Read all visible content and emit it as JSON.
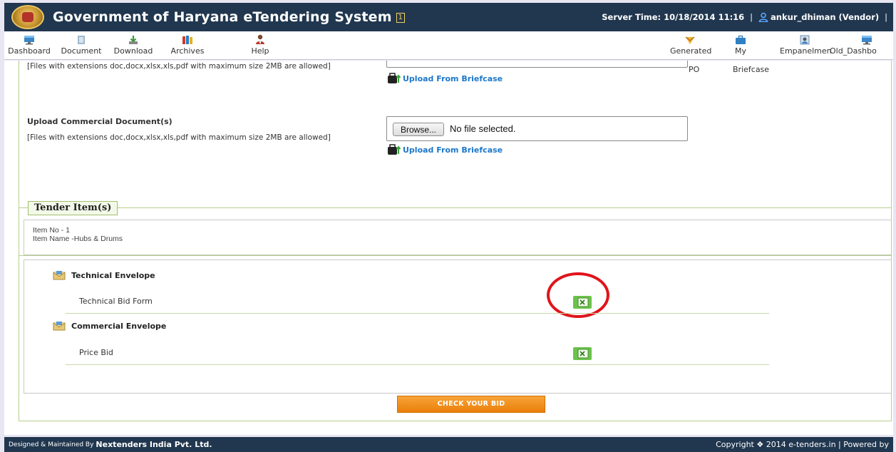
{
  "header": {
    "title": "Government of Haryana eTendering System",
    "badge": "1",
    "server_time": "Server Time: 10/18/2014 11:16",
    "separator": "|",
    "user": "ankur_dhiman (Vendor)",
    "user_trailing_sep": "|"
  },
  "toolbar": {
    "left": [
      {
        "label": "Dashboard",
        "icon": "dashboard-icon"
      },
      {
        "label": "Document",
        "icon": "document-icon"
      },
      {
        "label": "Download",
        "icon": "download-icon"
      },
      {
        "label": "Archives",
        "icon": "archives-icon"
      },
      {
        "label": "Help",
        "icon": "help-icon"
      }
    ],
    "right": [
      {
        "label": "Generated",
        "sub": "PO",
        "icon": "generated-po-icon"
      },
      {
        "label": "My",
        "sub": "Briefcase",
        "icon": "briefcase-icon"
      },
      {
        "label": "Empanelmen",
        "icon": "empanelment-icon"
      },
      {
        "label": "Old_Dashbo",
        "icon": "old-dashboard-icon"
      }
    ]
  },
  "technical_upload": {
    "note": "[Files with extensions doc,docx,xlsx,xls,pdf with maximum size 2MB are allowed]",
    "briefcase_link": "Upload From Briefcase"
  },
  "commercial_upload": {
    "label": "Upload Commercial Document(s)",
    "note": "[Files with extensions doc,docx,xlsx,xls,pdf with maximum size 2MB are allowed]",
    "browse": "Browse...",
    "file_status": "No file selected.",
    "briefcase_link": "Upload From Briefcase"
  },
  "tender_items": {
    "legend": "Tender Item(s)",
    "item_no": "Item No - 1",
    "item_name": "Item Name -Hubs & Drums",
    "envelopes": [
      {
        "title": "Technical Envelope",
        "row": "Technical Bid Form"
      },
      {
        "title": "Commercial Envelope",
        "row": "Price Bid"
      }
    ]
  },
  "actions": {
    "check_bid": "CHECK YOUR BID"
  },
  "footer": {
    "designed_by": "Designed & Maintained By",
    "company": "Nextenders India Pvt. Ltd.",
    "copyright": "Copyright ❖ 2014 e-tenders.in | Powered by"
  },
  "colors": {
    "header_bg": "#21374f",
    "link": "#1d77c9",
    "section_border": "#b7cf8a",
    "button_orange": "#ea7f0a",
    "highlight": "#e0141b"
  }
}
